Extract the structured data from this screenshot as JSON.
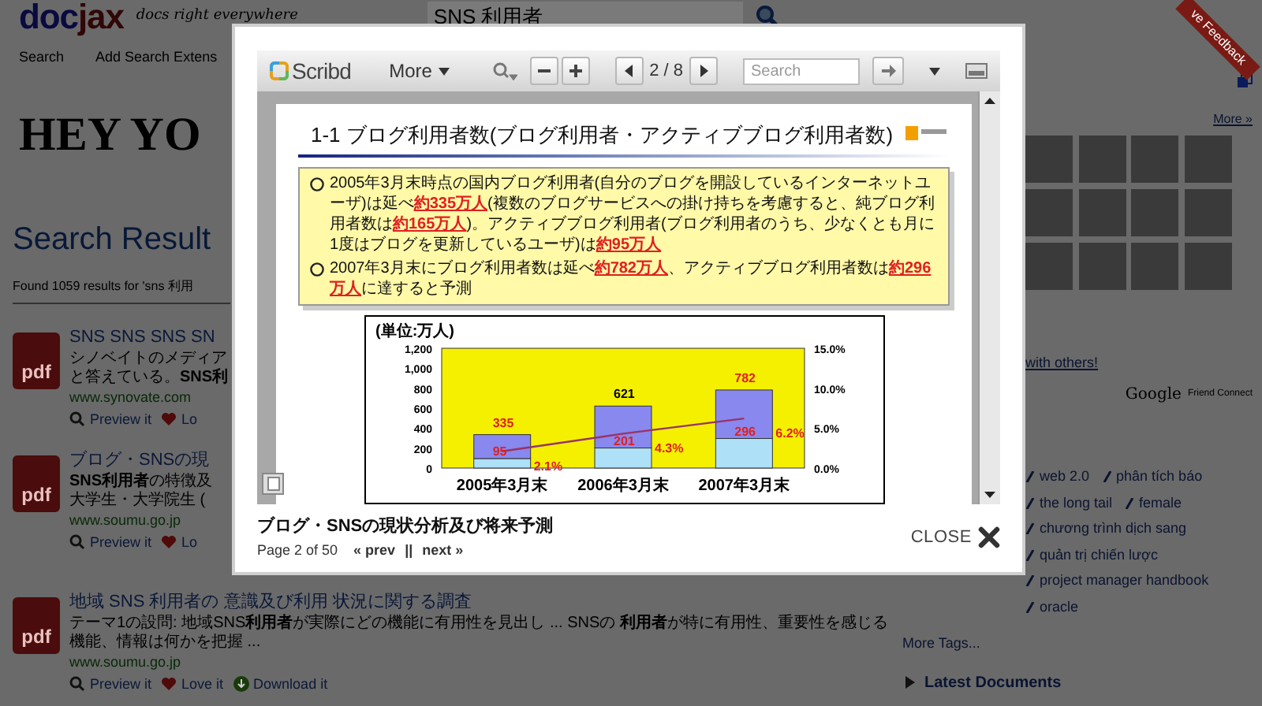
{
  "header": {
    "logo_left": "doc",
    "logo_right": "jax",
    "tagline": "docs right everywhere",
    "search_value": "SNS 利用者"
  },
  "nav": [
    "Search",
    "Add Search Extens"
  ],
  "banner": "HEY YO",
  "results_title": "Search Result",
  "results_count": "Found 1059 results for 'sns 利用",
  "results": [
    {
      "icon": "pdf",
      "title": "SNS SNS SNS SN",
      "snippet": [
        "シノベイトのメディア",
        "と答えている。**SNS利**"
      ],
      "url": "www.synovate.com",
      "actions": [
        "Preview it",
        "Lo"
      ]
    },
    {
      "icon": "pdf",
      "title": "ブログ・SNSの現",
      "snippet": [
        "**SNS利用者**の特徴及",
        "大学生・大学院生 ("
      ],
      "url": "www.soumu.go.jp",
      "actions": [
        "Preview it",
        "Lo"
      ]
    },
    {
      "icon": "pdf",
      "title": "地域 SNS 利用者の 意識及び利用 状況に関する調査",
      "snippet": [
        "テーマ1の設問: 地域SNS**利用者**が実際にどの機能に有用性を見出し ... SNSの **利用者**が特に有用性、重要性を感じる",
        "機能、情報は何かを把握 ..."
      ],
      "url": "www.soumu.go.jp",
      "actions": [
        "Preview it",
        "Love it",
        "Download it"
      ]
    }
  ],
  "sidebar": {
    "more_link": "More »",
    "share_link": "with others!",
    "gfc_brand": "Google",
    "gfc_label": "Friend Connect",
    "tags": [
      "web 2.0",
      "phân tích báo",
      "the long tail",
      "female",
      "chương trình dịch sang",
      "quản trị chiến lược",
      "project manager handbook",
      "oracle"
    ],
    "more_tags": "More Tags...",
    "latest": "Latest Documents"
  },
  "feedback": "ve Feedback",
  "viewer": {
    "toolbar": {
      "logo": "Scribd",
      "more": "More",
      "page": "2 / 8",
      "search_placeholder": "Search"
    },
    "doc": {
      "heading": "1-1 ブログ利用者数(ブログ利用者・アクティブブログ利用者数)",
      "bullets": [
        "2005年3月末時点の国内ブログ利用者(自分のブログを開設しているインターネットユーザ)は延べ**約335万人**(複数のブログサービスへの掛け持ちを考慮すると、純ブログ利用者数は**約165万人**)。アクティブブログ利用者(ブログ利用者のうち、少なくとも月に1度はブログを更新しているユーザ)は**約95万人**",
        "2007年3月末にブログ利用者数は延べ**約782万人**、アクティブブログ利用者数は**約296万人**に達すると予測"
      ],
      "chart_data": {
        "type": "bar",
        "stacked": true,
        "ylabel": "(単位:万人)",
        "categories": [
          "2005年3月末",
          "2006年3月末",
          "2007年3月末"
        ],
        "series": [
          {
            "color": "#aee0f8",
            "values": [
              95,
              201,
              296
            ]
          },
          {
            "color": "#8888ee",
            "values": [
              240,
              420,
              486
            ]
          },
          {
            "type": "line",
            "axis": "y2",
            "color": "#993366",
            "values": [
              2.1,
              4.3,
              6.2
            ]
          }
        ],
        "ylim": [
          0,
          1200
        ],
        "yticks": [
          {
            "value": 0,
            "label": "0"
          },
          {
            "value": 200,
            "label": "200"
          },
          {
            "value": 400,
            "label": "400"
          },
          {
            "value": 600,
            "label": "600"
          },
          {
            "value": 800,
            "label": "800"
          },
          {
            "value": 1000,
            "label": "1,000"
          },
          {
            "value": 1200,
            "label": "1,200"
          }
        ],
        "y2lim": [
          0,
          15
        ],
        "y2ticks": [
          {
            "value": 0,
            "label": "0.0%"
          },
          {
            "value": 5,
            "label": "5.0%"
          },
          {
            "value": 10,
            "label": "10.0%"
          },
          {
            "value": 15,
            "label": "15.0%"
          }
        ],
        "value_labels": [
          [
            "95",
            "201",
            "296"
          ],
          [
            "335",
            "621",
            "782"
          ],
          [
            "2.1%",
            "4.3%",
            "6.2%"
          ]
        ]
      }
    },
    "caption": {
      "title": "ブログ・SNSの現状分析及び将来予測",
      "page_info": "Page 2 of 50",
      "prev": "« prev",
      "separator": "||",
      "next": "next »",
      "close": "CLOSE"
    }
  }
}
